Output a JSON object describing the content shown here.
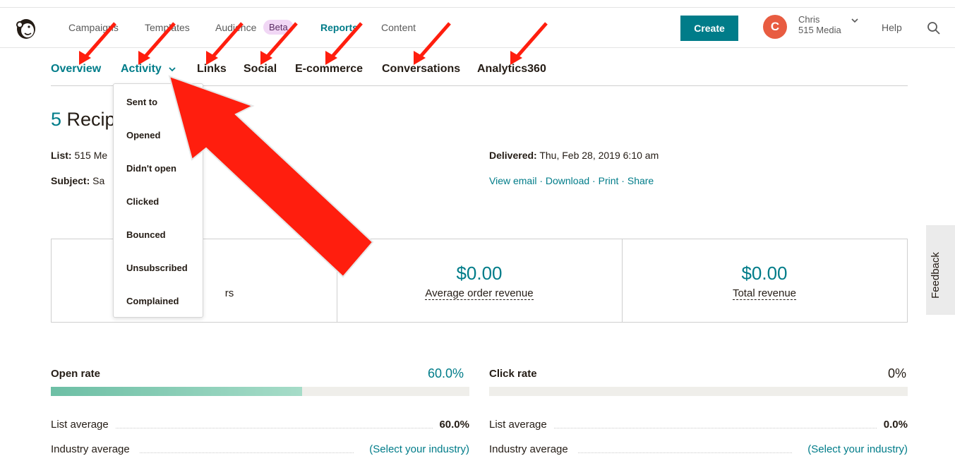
{
  "topnav": {
    "items": [
      "Campaigns",
      "Templates",
      "Audience",
      "Reports",
      "Content"
    ],
    "badge": "Beta",
    "create_label": "Create",
    "avatar_letter": "C",
    "user_name": "Chris",
    "user_org": "515 Media",
    "help_label": "Help"
  },
  "subnav": {
    "items": [
      "Overview",
      "Activity",
      "Links",
      "Social",
      "E-commerce",
      "Conversations",
      "Analytics360"
    ],
    "activity_chevron": "⌄"
  },
  "dropdown": {
    "items": [
      "Sent to",
      "Opened",
      "Didn't open",
      "Clicked",
      "Bounced",
      "Unsubscribed",
      "Complained"
    ]
  },
  "report": {
    "recipients_count": "5",
    "recipients_label": "Recip",
    "list_label": "List:",
    "list_value": "515 Me",
    "subject_label": "Subject:",
    "subject_value": "Sa",
    "delivered_label": "Delivered:",
    "delivered_value": "Thu, Feb 28, 2019 6:10 am",
    "actions": [
      "View email",
      "Download",
      "Print",
      "Share"
    ],
    "action_separator": "·"
  },
  "stats": {
    "col1_label_fragment": "rs",
    "avg_order_revenue_value": "$0.00",
    "avg_order_revenue_label": "Average order revenue",
    "total_revenue_value": "$0.00",
    "total_revenue_label": "Total revenue"
  },
  "open_rate": {
    "label": "Open rate",
    "value": "60.0%",
    "fill_fraction": 0.6,
    "list_average_label": "List average",
    "list_average_value": "60.0%",
    "industry_average_label": "Industry average",
    "industry_average_value": "(Select your industry)"
  },
  "click_rate": {
    "label": "Click rate",
    "value": "0%",
    "fill_fraction": 0,
    "list_average_label": "List average",
    "list_average_value": "0.0%",
    "industry_average_label": "Industry average",
    "industry_average_value": "(Select your industry)"
  },
  "feedback_label": "Feedback",
  "colors": {
    "brand_teal": "#007c89",
    "avatar": "#e85c41",
    "annotation_arrow": "#ff1e0e",
    "bar_fill": "#6dbfa5",
    "badge_bg": "#f1d7f5"
  },
  "icons": {
    "logo": "mailchimp-freddie-logo",
    "search": "search-icon",
    "user_menu": "chevron-down-icon"
  }
}
